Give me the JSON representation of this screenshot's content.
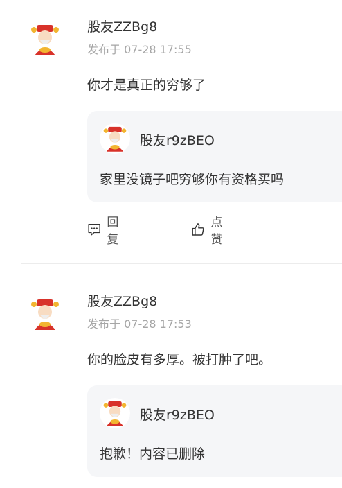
{
  "comments": [
    {
      "author": "股友ZZBg8",
      "meta": "发布于 07-28 17:55",
      "text": "你才是真正的穷够了",
      "quote": {
        "author": "股友r9zBEO",
        "text": "家里没镜子吧穷够你有资格买吗"
      },
      "actions": {
        "reply_label": "回复",
        "like_label": "点赞"
      }
    },
    {
      "author": "股友ZZBg8",
      "meta": "发布于 07-28 17:53",
      "text": "你的脸皮有多厚。被打肿了吧。",
      "quote": {
        "author": "股友r9zBEO",
        "text": "抱歉！内容已删除"
      }
    }
  ],
  "colors": {
    "text": "#333333",
    "meta": "#a6a6a6",
    "quote_bg": "#f5f6f8",
    "divider": "#ececec"
  },
  "icons": [
    "caishen-avatar-icon",
    "comment-icon",
    "thumbs-up-icon"
  ]
}
